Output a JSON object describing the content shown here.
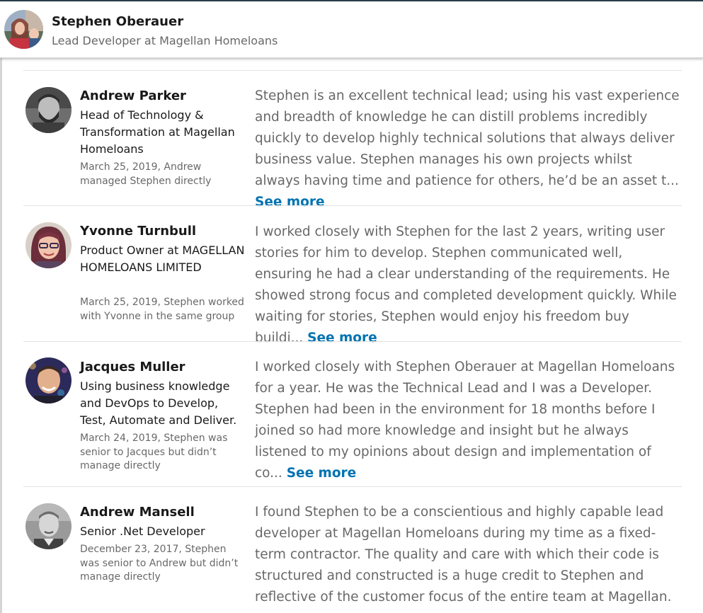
{
  "profile": {
    "name": "Stephen Oberauer",
    "headline": "Lead Developer at Magellan Homeloans"
  },
  "recommendations": [
    {
      "name": "Andrew Parker",
      "title": "Head of Technology & Transformation at Magellan Homeloans",
      "meta": "March 25, 2019, Andrew managed Stephen directly",
      "text": "Stephen is an excellent technical lead; using his vast experience and breadth of knowledge he can distill problems incredibly quickly to develop highly technical solutions that always deliver business value. Stephen manages his own projects whilst always having time and patience for others, he’d be an asset t...",
      "see_more": "See more"
    },
    {
      "name": "Yvonne Turnbull",
      "title": "Product Owner at MAGELLAN HOMELOANS LIMITED",
      "meta": "March 25, 2019, Stephen worked with Yvonne in the same group",
      "text": "I worked closely with Stephen for the last 2 years, writing user stories for him to develop. Stephen communicated well, ensuring he had a clear understanding of the requirements. He showed strong focus and completed development quickly. While waiting for stories, Stephen would enjoy his freedom buy buildi...",
      "see_more": "See more"
    },
    {
      "name": "Jacques Muller",
      "title": "Using business knowledge and DevOps to Develop, Test, Automate and Deliver.",
      "meta": "March 24, 2019, Stephen was senior to Jacques but didn’t manage directly",
      "text": "I worked closely with Stephen Oberauer at Magellan Homeloans for a year. He was the Technical Lead and I was a Developer. Stephen had been in the environment for 18 months before I joined so had more knowledge and insight but he always listened to my opinions about design and implementation of co...",
      "see_more": "See more"
    },
    {
      "name": "Andrew Mansell",
      "title": "Senior .Net Developer",
      "meta": "December 23, 2017, Stephen was senior to Andrew but didn’t manage directly",
      "text": "I found Stephen to be a conscientious and highly capable lead developer at Magellan Homeloans during my time as a fixed-term contractor. The quality and care with which their code is structured and constructed is a huge credit to Stephen and reflective of the customer focus of the entire team at Magellan."
    }
  ],
  "colors": {
    "link": "#0073b1",
    "topbar": "#283e4a"
  }
}
